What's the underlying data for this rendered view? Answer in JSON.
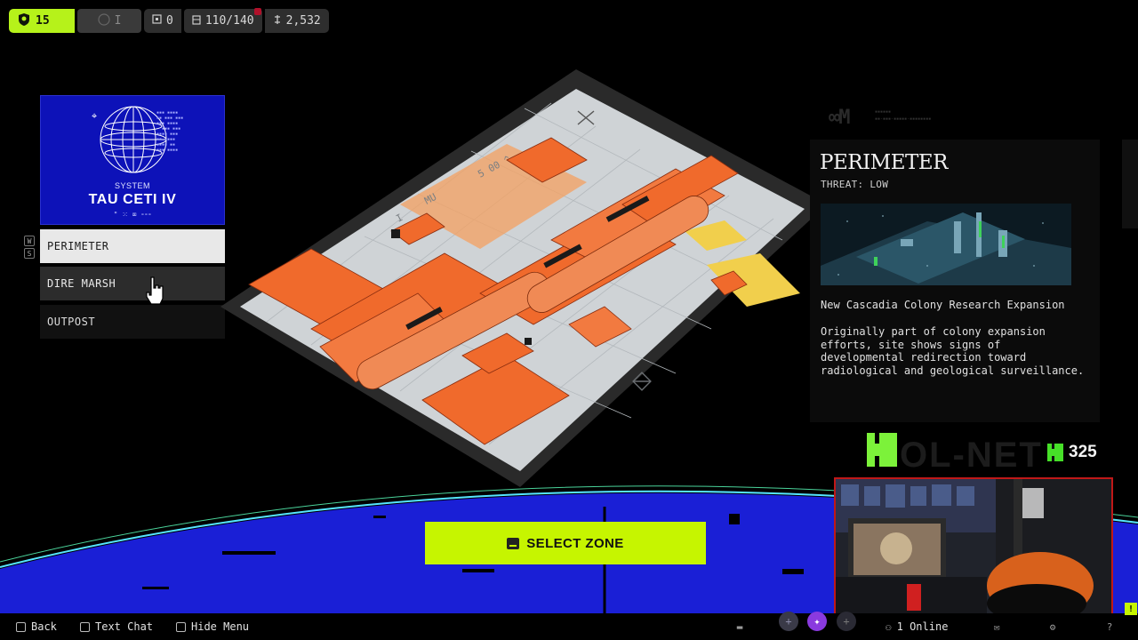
{
  "hud": {
    "level": "15",
    "rank": "I",
    "stat_box": "0",
    "inventory": "110/140",
    "currency": "2,532"
  },
  "system": {
    "label": "SYSTEM",
    "name": "TAU CETI IV",
    "glyphs": "\" ⁙ ⌧ ⁃⁃⁃"
  },
  "keyhints": [
    "W",
    "S"
  ],
  "zones": [
    {
      "label": "PERIMETER",
      "state": "selected"
    },
    {
      "label": "DIRE MARSH",
      "state": "hover"
    },
    {
      "label": "OUTPOST",
      "state": "normal"
    }
  ],
  "select_button": {
    "label": "SELECT ZONE"
  },
  "info": {
    "title": "PERIMETER",
    "threat": "THREAT: LOW",
    "subtitle": "New Cascadia Colony Research Expansion",
    "description": "Originally part of colony expansion efforts, site shows signs of developmental redirection toward radiological and geological surveillance."
  },
  "stream": {
    "points": "325"
  },
  "bottom_bar": {
    "back": "Back",
    "text_chat": "Text Chat",
    "hide_menu": "Hide Menu",
    "online": "1 Online"
  },
  "colors": {
    "accent": "#c6f500",
    "level_green": "#b6f21a",
    "system_blue": "#0d12b8",
    "map_orange": "#f06a2c",
    "planet_blue": "#1a1fd6",
    "webcam_border": "#c01818"
  },
  "icons": {
    "level": "shield-icon",
    "box": "box-icon",
    "inventory": "backpack-icon",
    "currency": "coin-icon",
    "select": "keyboard-key-icon",
    "back": "back-key-icon",
    "chat": "chat-icon",
    "menu": "menu-icon",
    "online": "people-icon",
    "mail": "mail-icon",
    "settings": "gear-icon",
    "help": "help-icon"
  }
}
